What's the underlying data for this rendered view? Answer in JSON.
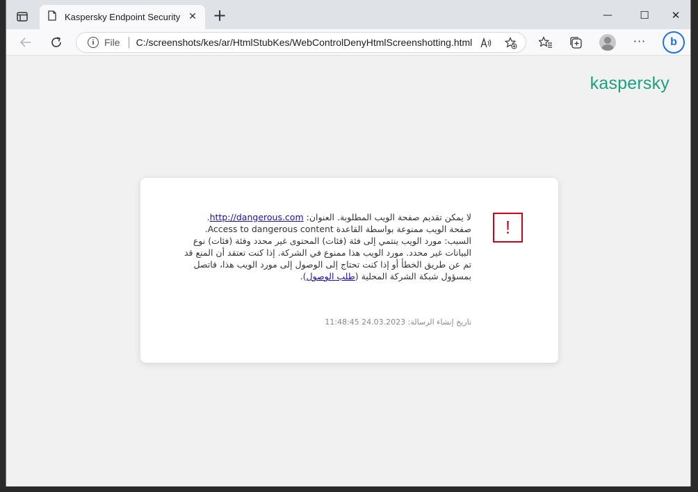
{
  "browser": {
    "tab_title": "Kaspersky Endpoint Security for Windows",
    "tab_close": "✕",
    "new_tab": "+",
    "address": {
      "protocol_label": "File",
      "url": "C:/screenshots/kes/ar/HtmlStubKes/WebControlDenyHtmlScreenshotting.html"
    },
    "window_controls": {
      "minimize": "—",
      "maximize": "☐",
      "close": "✕"
    },
    "more_label": "···"
  },
  "page": {
    "brand": "kaspersky",
    "alert_symbol": "!",
    "message": {
      "line1_prefix": "لا يمكن تقديم صفحة الويب المطلوبة. العنوان: ",
      "url_link": "http://dangerous.com",
      "line1_suffix": ".",
      "rule_text": "صفحة الويب ممنوعة بواسطة القاعدة Access to dangerous content.",
      "reason_text": "السبب: مورد الويب ينتمي إلى فئة (فئات) المحتوى غير محدد وفئة (فئات) نوع البيانات غير محدد. مورد الويب هذا ممنوع في الشركة. إذا كنت تعتقد أن المنع قد تم عن طريق الخطأ أو إذا كنت تحتاج إلى الوصول إلى مورد الويب هذا، فاتصل بمسؤول شبكة الشركة المحلية (",
      "request_link": "طلب الوصول",
      "reason_suffix": ")."
    },
    "timestamp": "تاريخ إنشاء الرسالة: 24.03.2023 11:48:45"
  },
  "colors": {
    "brand": "#1ba17f",
    "alert": "#d0021b",
    "link": "#1a0dab"
  }
}
